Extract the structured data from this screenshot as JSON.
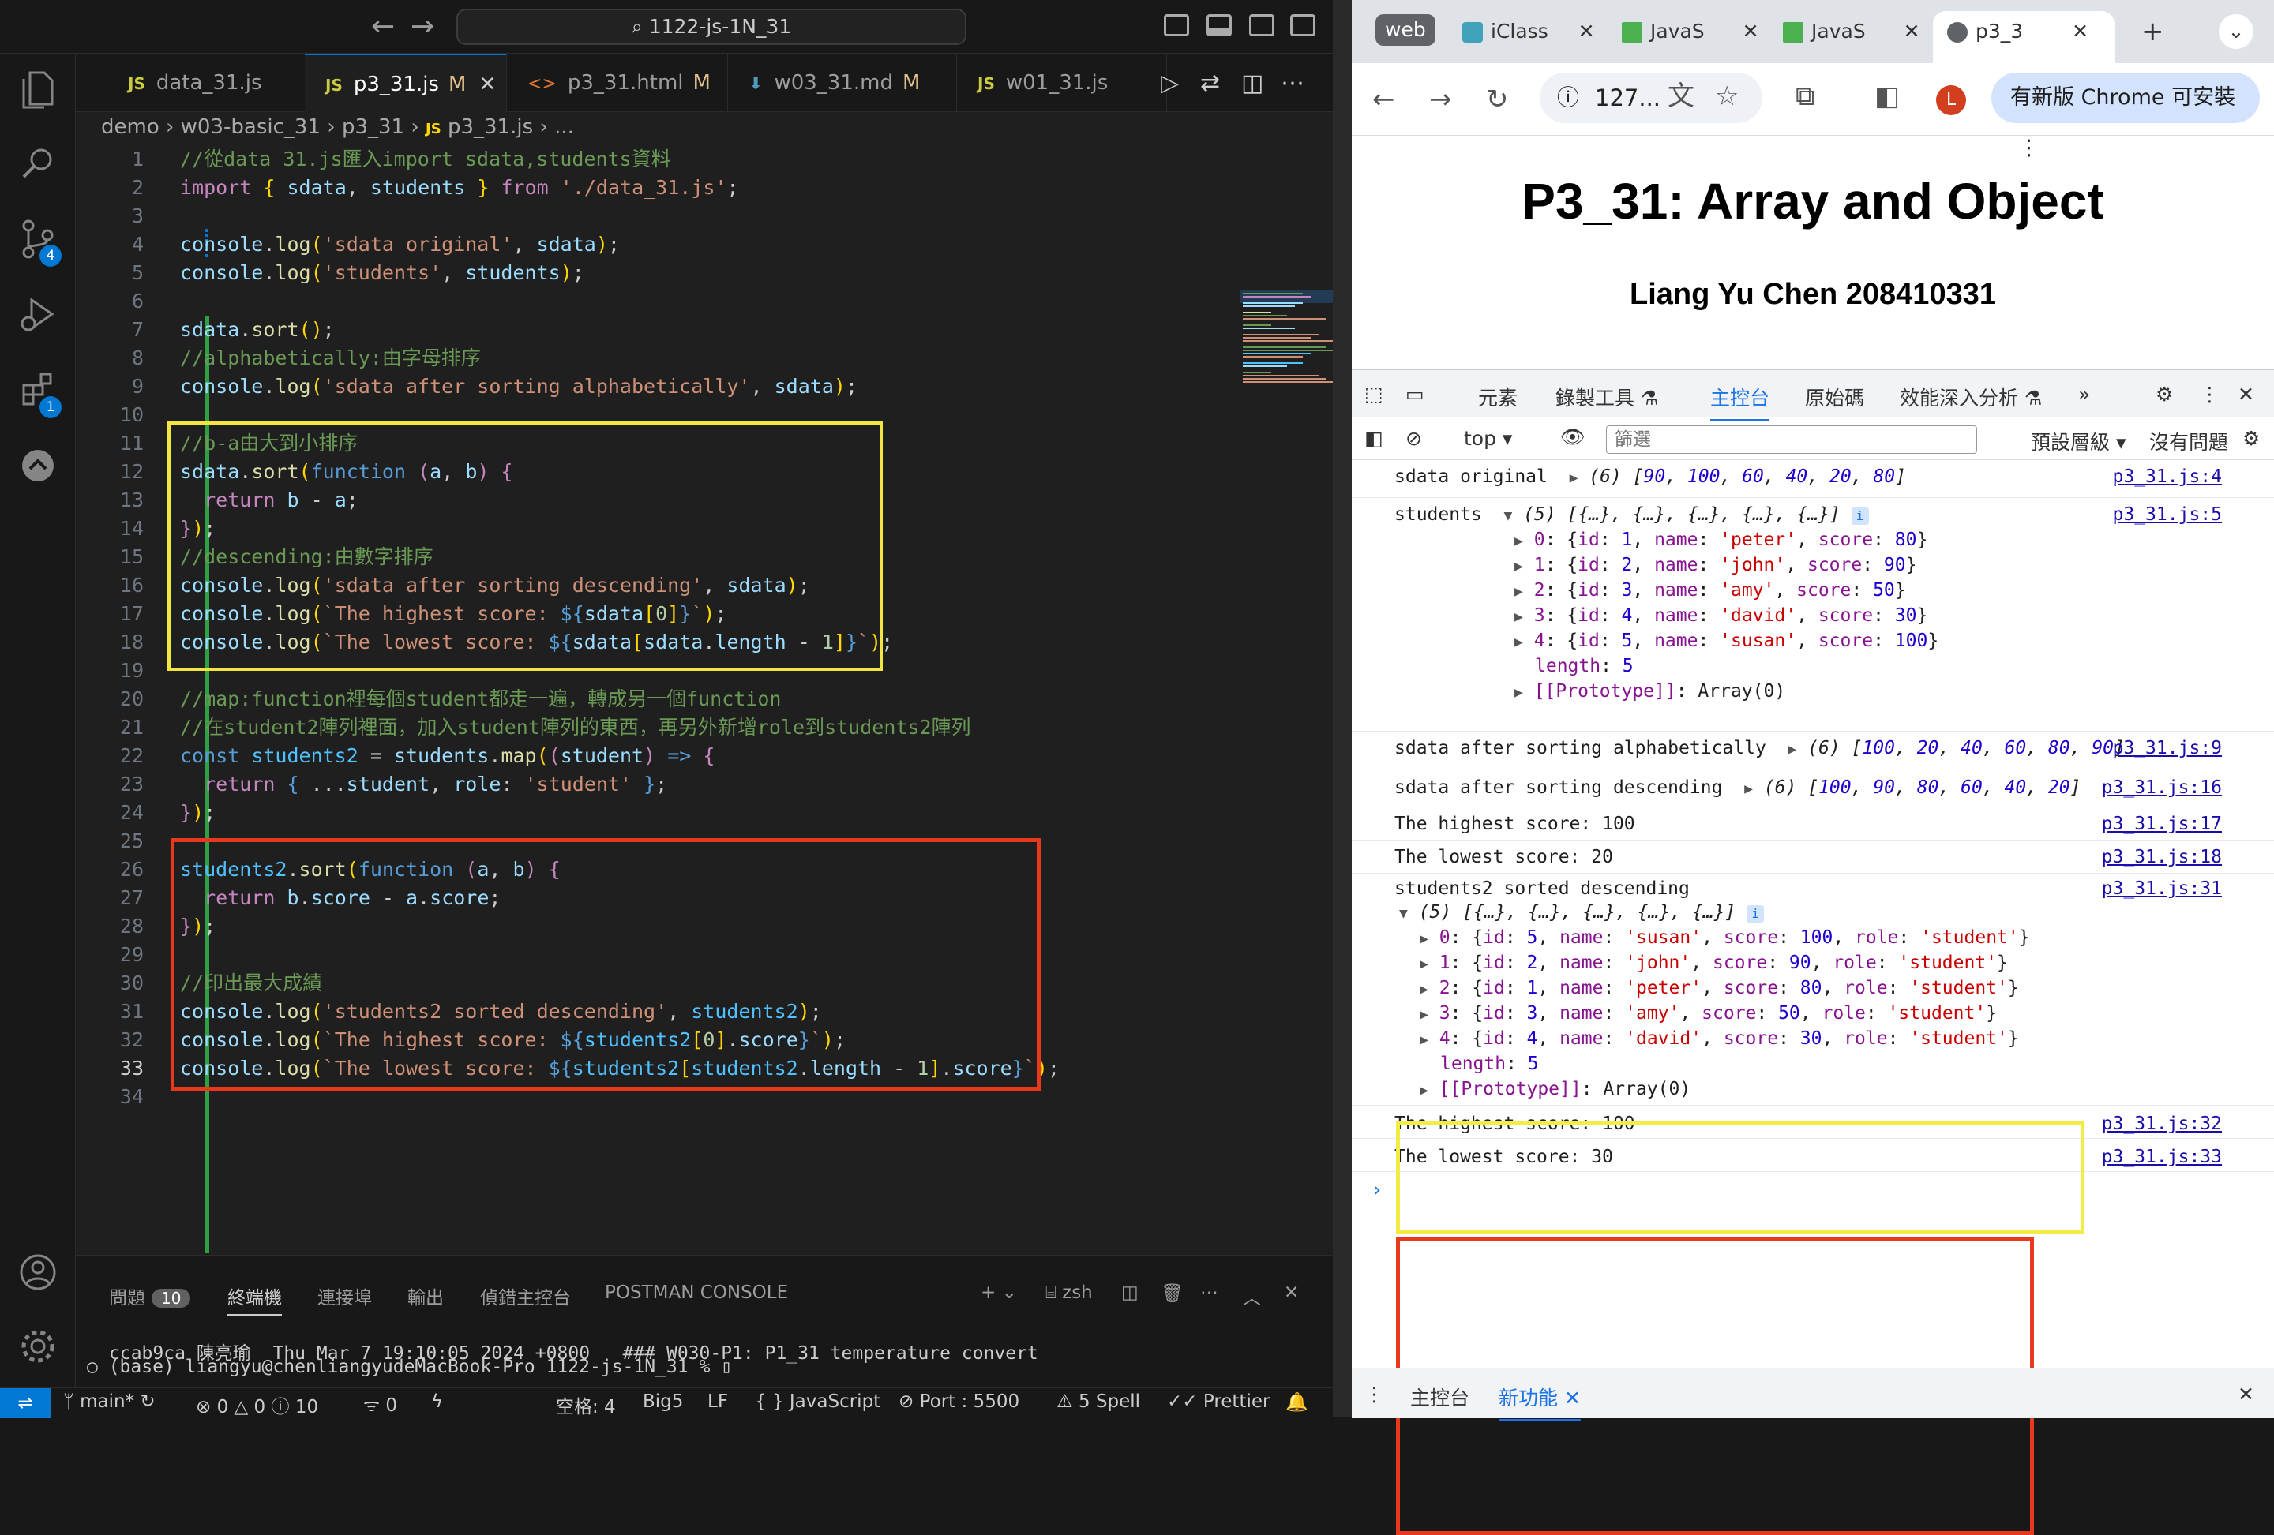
{
  "vscode": {
    "command_center": "1122-js-1N_31",
    "tabs": [
      {
        "label": "data_31.js",
        "mod": ""
      },
      {
        "label": "p3_31.js",
        "mod": "M"
      },
      {
        "label": "p3_31.html",
        "mod": "M"
      },
      {
        "label": "w03_31.md",
        "mod": "M"
      },
      {
        "label": "w01_31.js",
        "mod": ""
      }
    ],
    "tab_close": "✕",
    "breadcrumb": [
      "demo",
      "w03-basic_31",
      "p3_31",
      "p3_31.js",
      "..."
    ],
    "line_numbers": [
      "1",
      "2",
      "3",
      "4",
      "5",
      "6",
      "7",
      "8",
      "9",
      "10",
      "11",
      "12",
      "13",
      "14",
      "15",
      "16",
      "17",
      "18",
      "19",
      "20",
      "21",
      "22",
      "23",
      "24",
      "25",
      "26",
      "27",
      "28",
      "29",
      "30",
      "31",
      "32",
      "33",
      "34"
    ],
    "activity_badges": {
      "scm": "4",
      "extensions": "1"
    },
    "panel": {
      "tabs": [
        "問題",
        "終端機",
        "連接埠",
        "輸出",
        "偵錯主控台",
        "POSTMAN CONSOLE"
      ],
      "problems_count": "10",
      "shell": "zsh",
      "terminal_lines": [
        "ccab9ca 陳亮瑜  Thu Mar 7 19:10:05 2024 +0800   ### W030-P1: P1_31 temperature convert",
        "○ (base) liangyu@chenliangyudeMacBook-Pro 1122-js-1N_31 % ▯"
      ]
    },
    "statusbar": {
      "branch": "main*",
      "errors": "0",
      "warnings": "0",
      "infos": "10",
      "ports": "0",
      "spaces": "空格: 4",
      "encoding": "Big5",
      "eol": "LF",
      "language": "JavaScript",
      "port": "Port : 5500",
      "spell": "5 Spell",
      "prettier": "Prettier"
    }
  },
  "chrome": {
    "tabs": [
      {
        "label": "web"
      },
      {
        "label": "iClass"
      },
      {
        "label": "JavaS"
      },
      {
        "label": "JavaS"
      },
      {
        "label": "p3_3"
      }
    ],
    "tab_close": "✕",
    "omnibox": "127...",
    "profile_initial": "L",
    "update_label": "有新版 Chrome 可安裝",
    "page_title": "P3_31: Array and Object",
    "page_subtitle": "Liang Yu Chen 208410331",
    "devtools_tabs": [
      "元素",
      "錄製工具",
      "主控台",
      "原始碼",
      "效能深入分析"
    ],
    "context": "top",
    "filter_placeholder": "篩選",
    "levels": "預設層級",
    "issues": "沒有問題",
    "drawer_tabs": [
      "主控台",
      "新功能"
    ]
  },
  "colors": {
    "accent": "#0078d4",
    "yellow_box": "#f2e53d",
    "red_box": "#e8381e",
    "chrome_link": "#1a0dab"
  }
}
